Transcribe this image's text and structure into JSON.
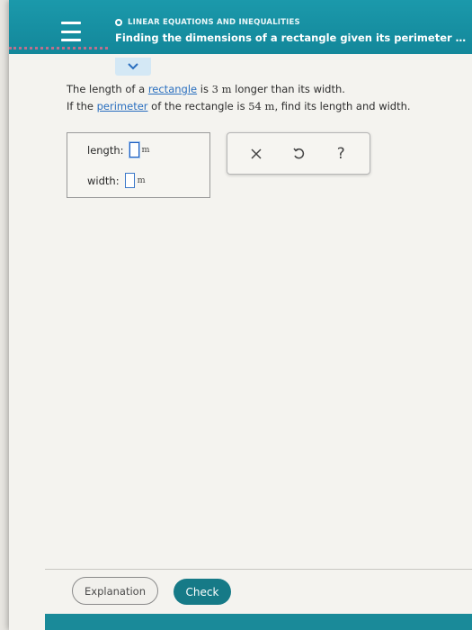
{
  "header": {
    "topic": "LINEAR EQUATIONS AND INEQUALITIES",
    "title": "Finding the dimensions of a rectangle given its perimeter and a..."
  },
  "problem": {
    "line1_pre": "The length of a ",
    "line1_link": "rectangle",
    "line1_mid": " is ",
    "line1_num": "3 m",
    "line1_post": " longer than its width.",
    "line2_pre": "If the ",
    "line2_link": "perimeter",
    "line2_mid": " of the rectangle is ",
    "line2_num": "54 m",
    "line2_post": ", find its length and width."
  },
  "answer": {
    "length_label": "length:",
    "length_value": "",
    "length_unit": "m",
    "width_label": "width:",
    "width_value": "",
    "width_unit": "m"
  },
  "tools": {
    "clear_icon": "close-icon",
    "undo_icon": "undo-icon",
    "help_label": "?"
  },
  "footer": {
    "explanation_label": "Explanation",
    "check_label": "Check"
  },
  "colors": {
    "header": "#168fa1",
    "check_button": "#167a87",
    "link": "#2a6fbf",
    "input_border": "#3a77c9"
  }
}
